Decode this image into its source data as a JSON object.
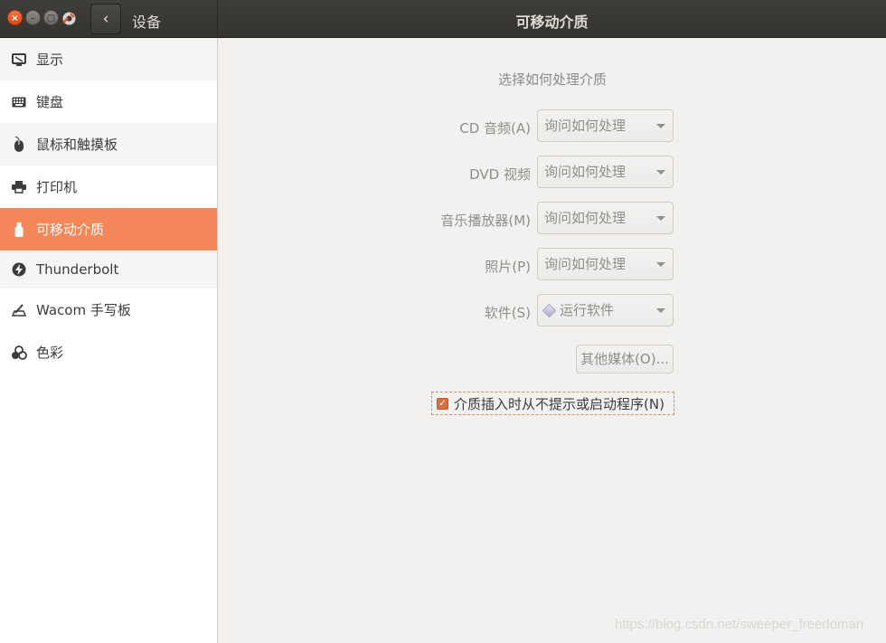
{
  "window": {
    "section": "设备",
    "title": "可移动介质",
    "back_symbol": "‹"
  },
  "sidebar": {
    "items": [
      {
        "label": "显示",
        "icon": "display-icon"
      },
      {
        "label": "键盘",
        "icon": "keyboard-icon"
      },
      {
        "label": "鼠标和触摸板",
        "icon": "mouse-icon"
      },
      {
        "label": "打印机",
        "icon": "printer-icon"
      },
      {
        "label": "可移动介质",
        "icon": "usb-drive-icon",
        "active": true
      },
      {
        "label": "Thunderbolt",
        "icon": "thunderbolt-icon"
      },
      {
        "label": "Wacom 手写板",
        "icon": "tablet-icon"
      },
      {
        "label": "色彩",
        "icon": "color-icon"
      }
    ]
  },
  "main": {
    "heading": "选择如何处理介质",
    "rows": [
      {
        "label": "CD 音频(A)",
        "value": "询问如何处理"
      },
      {
        "label": "DVD 视频",
        "value": "询问如何处理"
      },
      {
        "label": "音乐播放器(M)",
        "value": "询问如何处理"
      },
      {
        "label": "照片(P)",
        "value": "询问如何处理"
      },
      {
        "label": "软件(S)",
        "value": "运行软件"
      }
    ],
    "other_media_button": "其他媒体(O)...",
    "never_prompt_checkbox": {
      "label": "介质插入时从不提示或启动程序(N)",
      "checked": true
    }
  },
  "watermark": "https://blog.csdn.net/sweeper_freedoman",
  "colors": {
    "accent": "#f4875a",
    "titlebar": "#3b3935",
    "checkbox": "#d8703f"
  }
}
